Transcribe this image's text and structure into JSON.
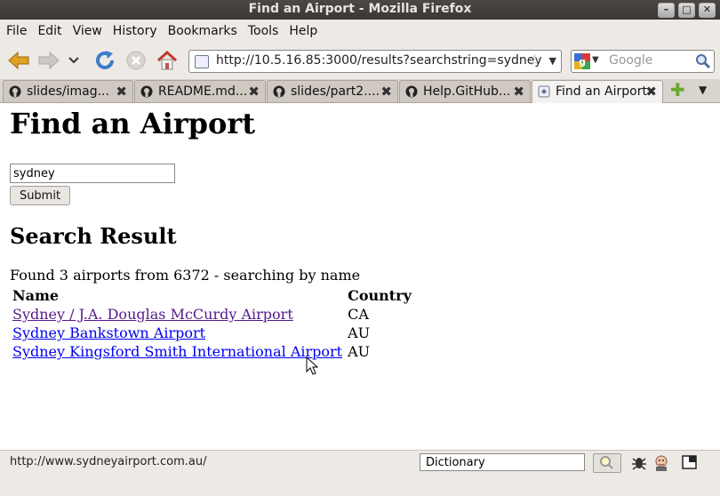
{
  "window": {
    "title": "Find an Airport - Mozilla Firefox"
  },
  "menu": [
    "File",
    "Edit",
    "View",
    "History",
    "Bookmarks",
    "Tools",
    "Help"
  ],
  "nav": {
    "url": "http://10.5.16.85:3000/results?searchstring=sydney",
    "search_placeholder": "Google"
  },
  "tabs": [
    {
      "label": "slides/imag...",
      "icon": "github-icon"
    },
    {
      "label": "README.md...",
      "icon": "github-icon"
    },
    {
      "label": "slides/part2....",
      "icon": "github-icon"
    },
    {
      "label": "Help.GitHub...",
      "icon": "github-icon"
    },
    {
      "label": "Find an Airport",
      "icon": "page-icon",
      "active": true
    }
  ],
  "page": {
    "heading": "Find an Airport",
    "search_value": "sydney",
    "submit_label": "Submit",
    "result_heading": "Search Result",
    "summary": "Found 3 airports from 6372 - searching by name",
    "columns": [
      "Name",
      "Country"
    ],
    "rows": [
      {
        "name": "Sydney / J.A. Douglas McCurdy Airport",
        "country": "CA",
        "visited": true
      },
      {
        "name": "Sydney Bankstown Airport",
        "country": "AU",
        "visited": false
      },
      {
        "name": "Sydney Kingsford Smith International Airport",
        "country": "AU",
        "visited": false
      }
    ]
  },
  "status": {
    "text": "http://www.sydneyairport.com.au/",
    "dictionary_value": "Dictionary"
  }
}
